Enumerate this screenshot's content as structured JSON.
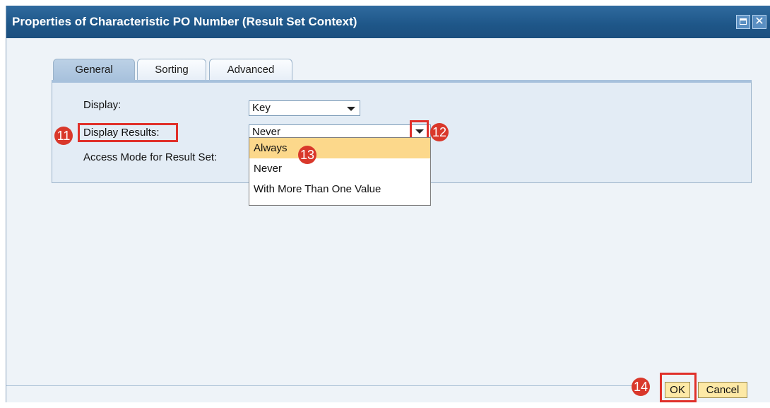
{
  "dialog": {
    "title": "Properties of Characteristic PO Number (Result Set Context)"
  },
  "tabs": [
    {
      "label": "General",
      "active": true
    },
    {
      "label": "Sorting",
      "active": false
    },
    {
      "label": "Advanced",
      "active": false
    }
  ],
  "form": {
    "display_label": "Display:",
    "display_value": "Key",
    "display_results_label": "Display Results:",
    "display_results_value": "Never",
    "access_mode_label": "Access Mode for Result Set:"
  },
  "dropdown_options": [
    {
      "label": "Always",
      "highlighted": true
    },
    {
      "label": "Never",
      "highlighted": false
    },
    {
      "label": "With More Than One Value",
      "highlighted": false
    }
  ],
  "callouts": [
    "11",
    "12",
    "13",
    "14"
  ],
  "buttons": {
    "ok_label": "OK",
    "cancel_label": "Cancel"
  },
  "colors": {
    "title_bar": "#1e5688",
    "highlight": "#fcd88b",
    "callout": "#d9382b"
  }
}
